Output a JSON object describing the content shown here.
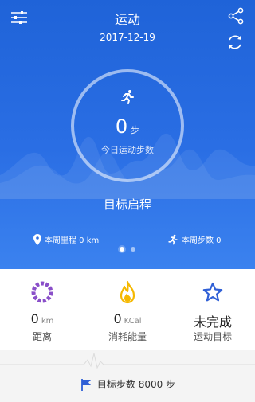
{
  "header": {
    "title": "运动",
    "date": "2017-12-19"
  },
  "ring": {
    "steps": "0",
    "steps_unit": "步",
    "label": "今日运动步数"
  },
  "goal": {
    "title": "目标启程"
  },
  "week": {
    "distance_label": "本周里程 0 km",
    "steps_label": "本周步数 0"
  },
  "pager": {
    "active_index": 0,
    "count": 2
  },
  "stats": [
    {
      "value": "0",
      "unit": "km",
      "label": "距离",
      "icon": "ring-progress-icon",
      "color": "#8a4fc9"
    },
    {
      "value": "0",
      "unit": "KCal",
      "label": "消耗能量",
      "icon": "flame-icon",
      "color": "#f5b800"
    },
    {
      "value": "未完成",
      "unit": "",
      "label": "运动目标",
      "icon": "star-icon",
      "color": "#2f5fd6"
    }
  ],
  "footer": {
    "goal_steps": "目标步数 8000 步"
  },
  "colors": {
    "primary": "#2a6ee4",
    "background": "#ffffff"
  }
}
